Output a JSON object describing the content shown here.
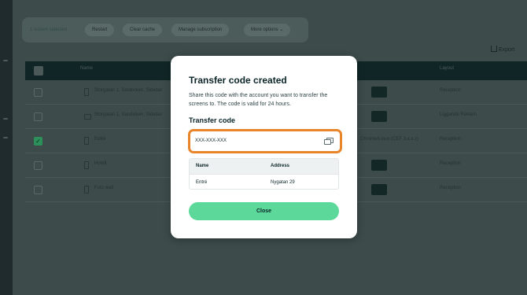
{
  "toolbar": {
    "selected_label": "1 screen selected",
    "buttons": [
      "Restart",
      "Clear cache",
      "Manage subscription",
      "More options"
    ],
    "export_label": "Export"
  },
  "table": {
    "headers": {
      "name": "Name",
      "layout": "Layout"
    },
    "rows": [
      {
        "name": "Storgatan 1, Sandviken, Sidebar",
        "layout": "Reception",
        "checked": false,
        "device": "phone"
      },
      {
        "name": "Storgatan 1, Sandviken, Sidebar",
        "layout": "Liggande Reklam",
        "checked": false,
        "device": "tv"
      },
      {
        "name": "Entré",
        "extra": "Chrome/Linux (CEF 3.x.x.x)",
        "layout": "Reception",
        "checked": true,
        "device": "phone"
      },
      {
        "name": "Hotell",
        "layout": "Reception",
        "checked": false,
        "device": "phone"
      },
      {
        "name": "Foto wall",
        "layout": "Reception",
        "checked": false,
        "device": "phone"
      }
    ]
  },
  "modal": {
    "title": "Transfer code created",
    "description": "Share this code with the account you want to transfer the screens to. The code is valid for 24 hours.",
    "code_label": "Transfer code",
    "code_value": "XXX-XXX-XXX",
    "copy_icon": "copy-icon",
    "table": {
      "headers": [
        "Name",
        "Address"
      ],
      "row": [
        "Entré",
        "Nygatan 29"
      ]
    },
    "close_label": "Close",
    "highlight_color": "#e8852a",
    "button_color": "#5cd99a"
  }
}
